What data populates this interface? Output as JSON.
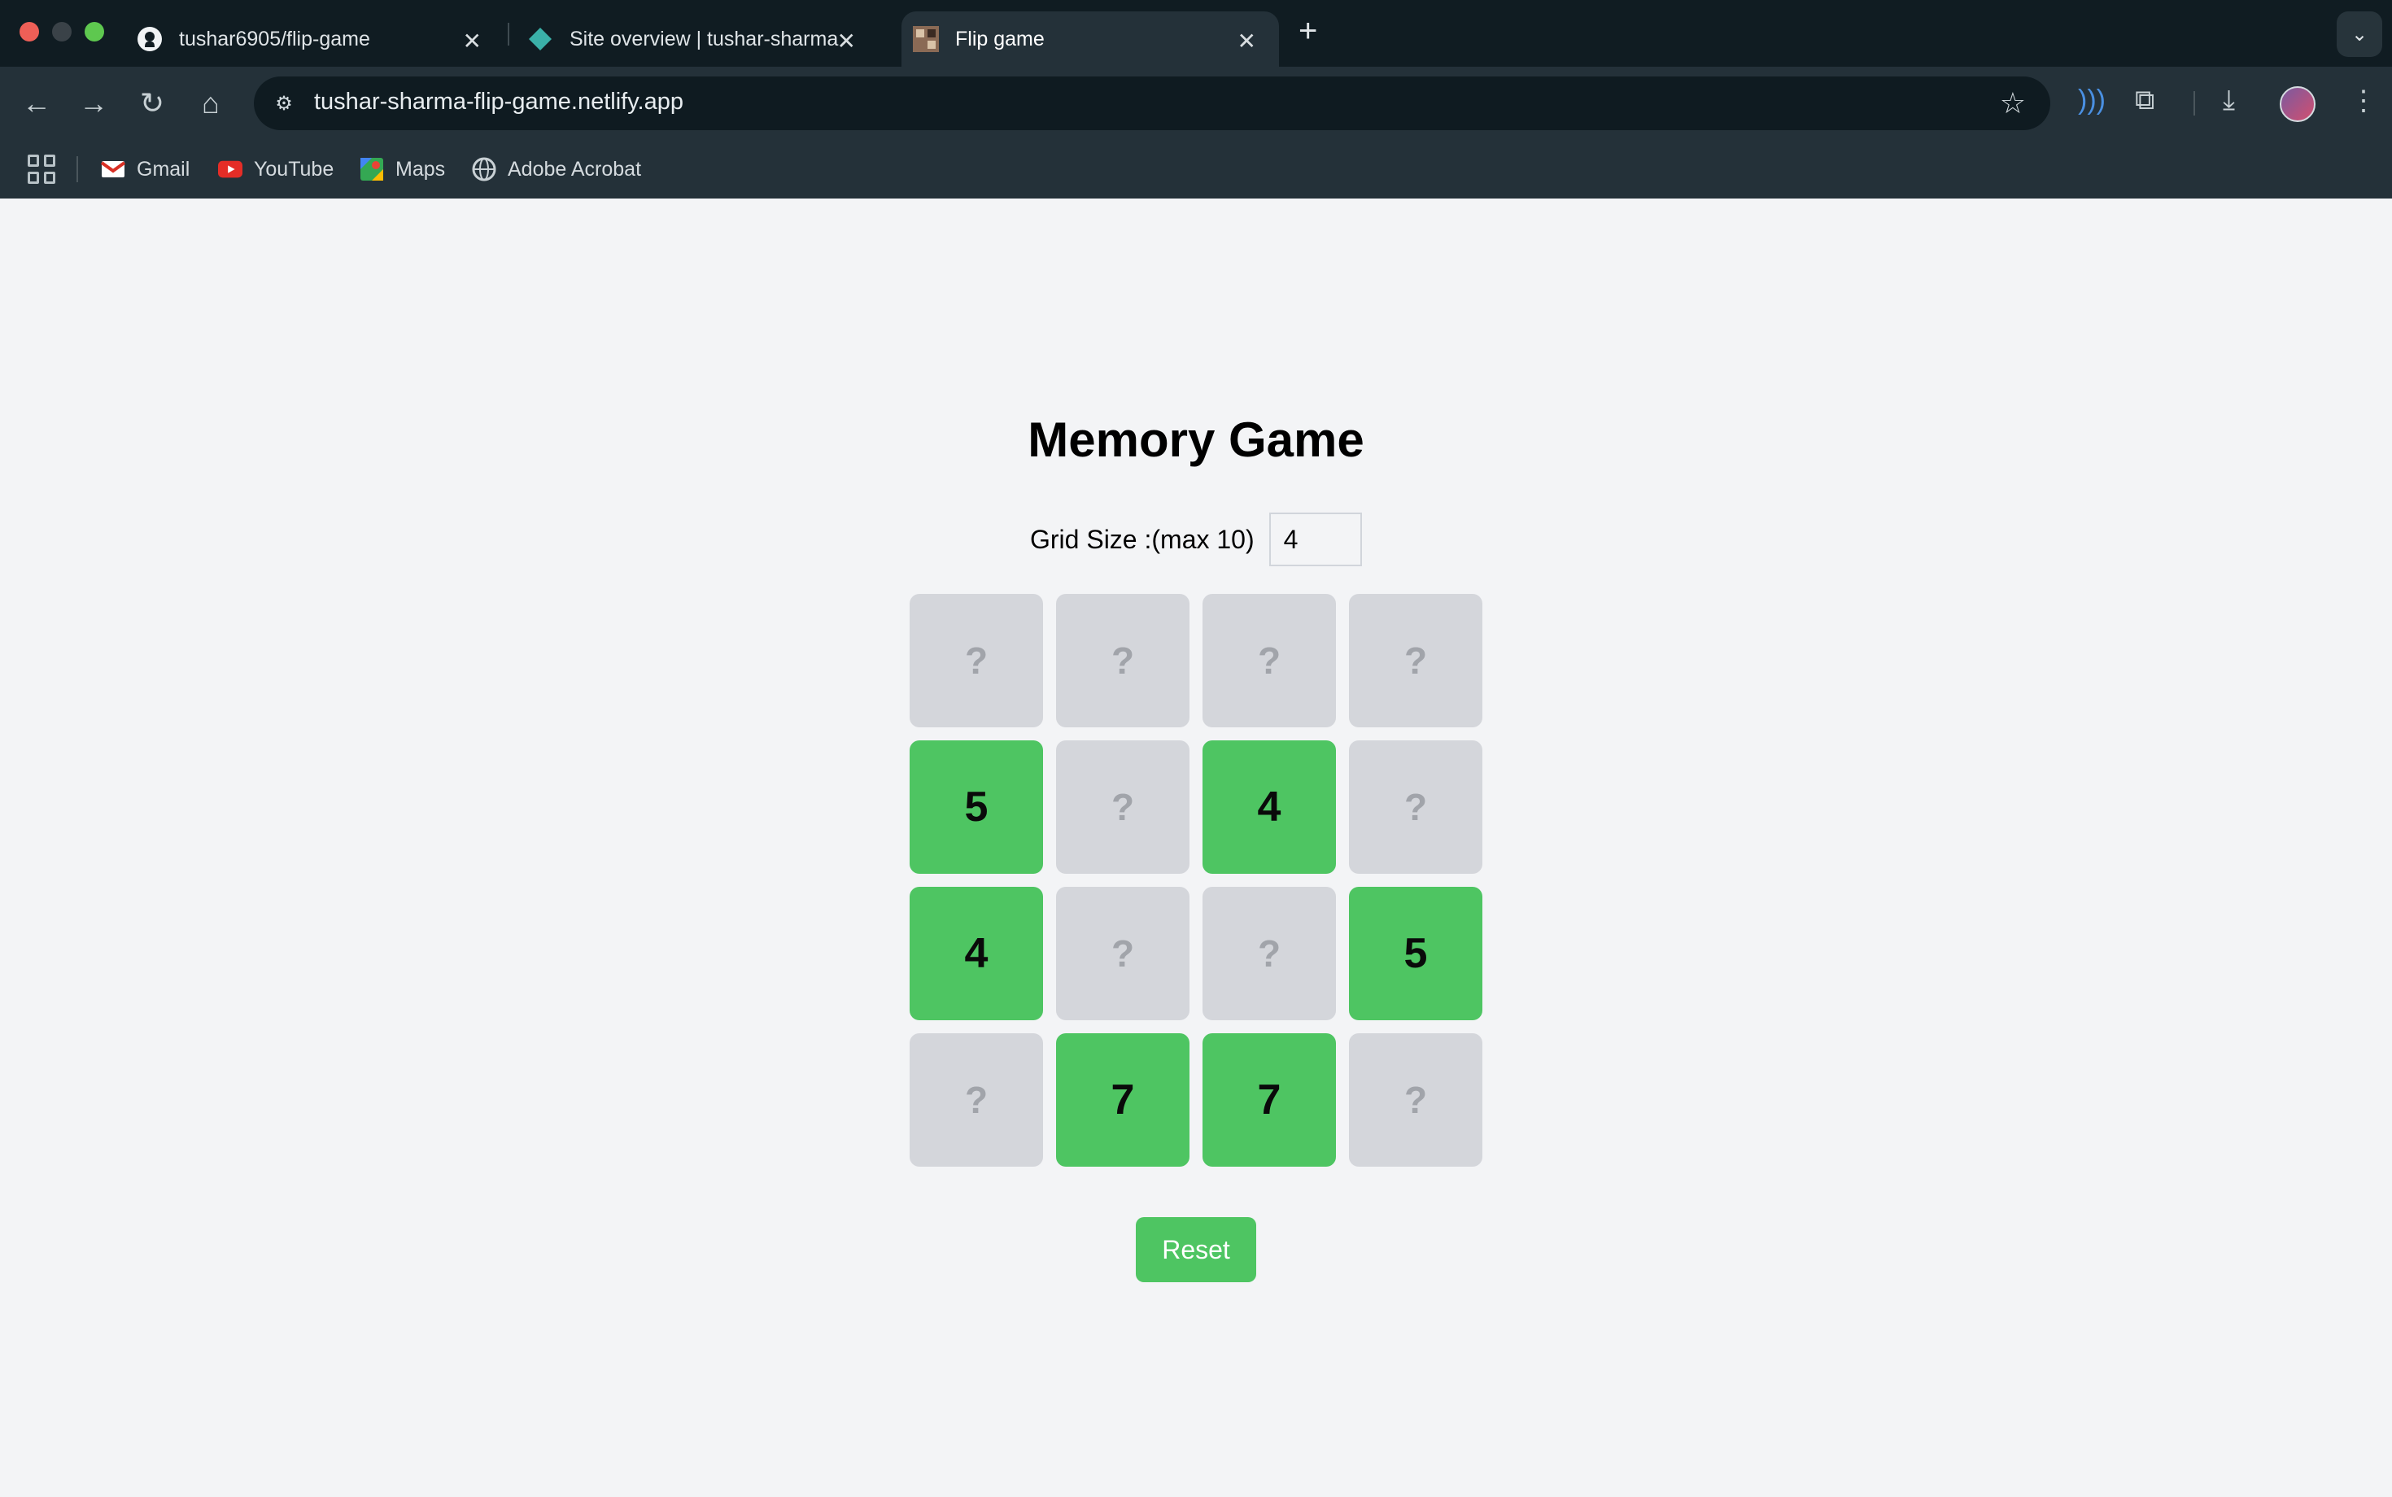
{
  "browser": {
    "tabs": [
      {
        "title": "tushar6905/flip-game",
        "icon": "github-icon",
        "active": false
      },
      {
        "title": "Site overview | tushar-sharma",
        "icon": "netlify-icon",
        "active": false
      },
      {
        "title": "Flip game",
        "icon": "site-favicon",
        "active": true
      }
    ],
    "url": "tushar-sharma-flip-game.netlify.app",
    "bookmarks": [
      {
        "label": "Gmail",
        "icon": "gmail-icon"
      },
      {
        "label": "YouTube",
        "icon": "youtube-icon"
      },
      {
        "label": "Maps",
        "icon": "maps-icon"
      },
      {
        "label": "Adobe Acrobat",
        "icon": "globe-icon"
      }
    ],
    "colors": {
      "tabstrip": "#101c22",
      "toolbar": "#243139",
      "omnibox": "#0f1b21"
    }
  },
  "page": {
    "title": "Memory Game",
    "grid_size_label": "Grid Size :(max 10)",
    "grid_size_value": "4",
    "reset_label": "Reset",
    "hidden_symbol": "?",
    "cards": [
      "?",
      "?",
      "?",
      "?",
      "5",
      "?",
      "4",
      "?",
      "4",
      "?",
      "?",
      "5",
      "?",
      "7",
      "7",
      "?"
    ],
    "colors": {
      "matched": "#4ec562",
      "hidden": "#d4d6db",
      "background": "#f3f4f6"
    }
  }
}
